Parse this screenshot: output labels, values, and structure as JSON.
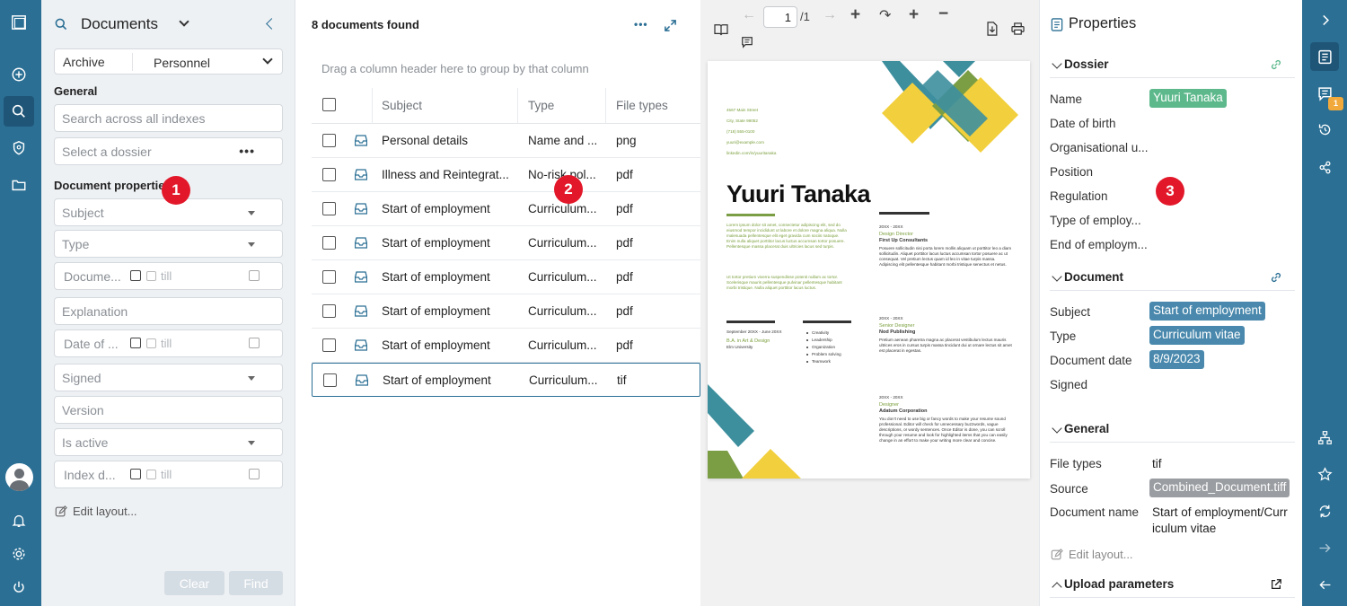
{
  "search_panel": {
    "title": "Documents",
    "archive_label": "Archive",
    "archive_value": "Personnel",
    "general_label": "General",
    "search_placeholder": "Search across all indexes",
    "dossier_placeholder": "Select a dossier",
    "doc_props_label": "Document properties",
    "fields": {
      "subject": "Subject",
      "type": "Type",
      "document_date": "Docume...",
      "explanation": "Explanation",
      "date_of": "Date of ...",
      "signed": "Signed",
      "version": "Version",
      "is_active": "Is active",
      "index_date": "Index d...",
      "till": "till"
    },
    "edit_layout": "Edit layout...",
    "clear": "Clear",
    "find": "Find"
  },
  "results": {
    "count": "8 documents found",
    "group_hint": "Drag a column header here to group by that column",
    "columns": [
      "Subject",
      "Type",
      "File types"
    ],
    "rows": [
      {
        "subject": "Personal details",
        "type": "Name and ...",
        "file": "png"
      },
      {
        "subject": "Illness and Reintegrat...",
        "type": "No-risk pol...",
        "file": "pdf"
      },
      {
        "subject": "Start of employment",
        "type": "Curriculum...",
        "file": "pdf"
      },
      {
        "subject": "Start of employment",
        "type": "Curriculum...",
        "file": "pdf"
      },
      {
        "subject": "Start of employment",
        "type": "Curriculum...",
        "file": "pdf"
      },
      {
        "subject": "Start of employment",
        "type": "Curriculum...",
        "file": "pdf"
      },
      {
        "subject": "Start of employment",
        "type": "Curriculum...",
        "file": "pdf"
      },
      {
        "subject": "Start of employment",
        "type": "Curriculum...",
        "file": "tif"
      }
    ]
  },
  "viewer": {
    "page": "1",
    "page_total": "/1",
    "doc": {
      "name": "Yuuri Tanaka",
      "contact": [
        "4567 Main Street",
        "City, State 98052",
        "(718) 555-0100",
        "yuuri@example.com",
        "linkedin.com/in/yuuritanaka"
      ],
      "intro": "Lorem ipsum dolor sit amet, consectetur adipiscing elit, sed do eiusmod tempor incididunt ut labore et dolore magna aliqua. Nulla malesuada pellentesque elit eget gravida cum sociis natoque. Enim nulla aliquet porttitor lacus luctus accumsan tortor posuere. Pellentesque massa placerat duis ultricies lacus sed turpis.",
      "intro2": "Ut tortor pretium viverra suspendisse potenti nullam ac tortor. Scelerisque mauris pellentesque pulvinar pellentesque habitant morbi tristique. Nulla aliquet porttitor lacus luctus.",
      "education_dates": "September 20XX - June 20XX",
      "education_degree": "B.A. in Art & Design",
      "education_school": "Elm University",
      "skills": [
        "Creativity",
        "Leadership",
        "Organization",
        "Problem solving",
        "Teamwork"
      ],
      "jobs": [
        {
          "dates": "20XX - 20XX",
          "title": "Design Director",
          "company": "First Up Consultants",
          "text": "Posuere sollicitudin nisi porta lorem mollis aliquam ut porttitor leo a diam sollicitudin. Aliquet porttitor lacus luctus accumsan tortor posuere ac ut consequat. Vel pretium lectus quam id leo in vitae turpis massa. Adipiscing elit pellentesque habitant morbi tristique senectus et netus."
        },
        {
          "dates": "20XX - 20XX",
          "title": "Senior Designer",
          "company": "Nod Publishing",
          "text": "Pretium aenean pharetra magna ac placerat vestibulum lectus mauris ultrices eros in cursus turpis massa tincidunt dui ut ornare lectus sit amet est placerat in egestas."
        },
        {
          "dates": "20XX - 20XX",
          "title": "Designer",
          "company": "Adatum Corporation",
          "text": "You don't need to use big or fancy words to make your resume sound professional. Editor will check for unnecessary buzzwords, vague descriptions, or wordy sentences. Once Editor is done, you can scroll through your resume and look for highlighted items that you can easily change in an effort to make your writing more clear and concise."
        }
      ]
    }
  },
  "properties": {
    "title": "Properties",
    "dossier": {
      "title": "Dossier",
      "name_label": "Name",
      "name_value": "Yuuri Tanaka",
      "labels": [
        "Date of birth",
        "Organisational u...",
        "Position",
        "Regulation",
        "Type of employ...",
        "End of employm..."
      ]
    },
    "document": {
      "title": "Document",
      "subject_label": "Subject",
      "subject_value": "Start of employment",
      "type_label": "Type",
      "type_value": "Curriculum vitae",
      "date_label": "Document date",
      "date_value": "8/9/2023",
      "signed_label": "Signed"
    },
    "general": {
      "title": "General",
      "file_types_label": "File types",
      "file_types_value": "tif",
      "source_label": "Source",
      "source_value": "Combined_Document.tiff",
      "doc_name_label": "Document name",
      "doc_name_value_1": "Start of employment/Curr",
      "doc_name_value_2": "iculum vitae"
    },
    "edit_layout": "Edit layout...",
    "upload_params": "Upload parameters"
  },
  "rail_right": {
    "notification_count": "1"
  },
  "badges": [
    "1",
    "2",
    "3"
  ],
  "colors": {
    "rail": "#2b6f94",
    "tag_green": "#5db98c",
    "tag_blue": "#4a89ad",
    "tag_gray": "#9a9da1",
    "badge_red": "#e2182a",
    "cv_teal": "#3d8f9e",
    "cv_yellow": "#f2cf3c",
    "cv_green": "#7b9e45"
  }
}
